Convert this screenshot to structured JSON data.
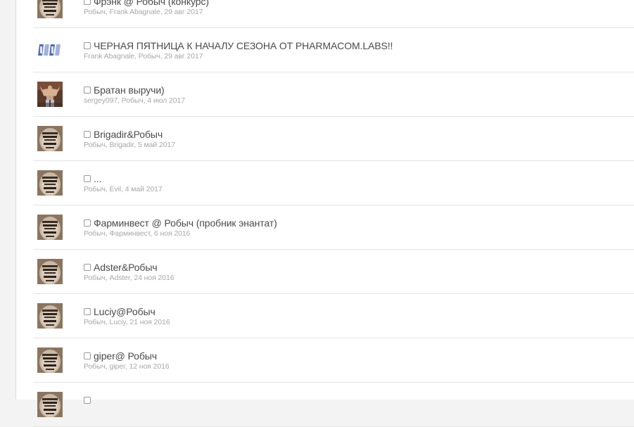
{
  "conversations": [
    {
      "title": "Фрэнк @ Робыч (конкурс)",
      "meta": "Робыч, Frank Abagnale, 29 авг 2017",
      "avatar": "robych-avatar"
    },
    {
      "title": "ЧЕРНАЯ ПЯТНИЦА К НАЧАЛУ СЕЗОНА ОТ PHARMACOM.LABS!!",
      "meta": "Frank Abagnale, Робыч, 29 авг 2017",
      "avatar": "pharmacom-logo"
    },
    {
      "title": "Братан выручи)",
      "meta": "sergey097, Робыч, 4 июл 2017",
      "avatar": "bodybuilder-avatar"
    },
    {
      "title": "Brigadir&Робыч",
      "meta": "Робыч, Brigadir, 5 май 2017",
      "avatar": "robych-avatar"
    },
    {
      "title": "...",
      "meta": "Робыч, Evil, 4 май 2017",
      "avatar": "robych-avatar"
    },
    {
      "title": "Фарминвест @ Робыч (пробник энантат)",
      "meta": "Робыч, Фарминвест, 6 ноя 2016",
      "avatar": "robych-avatar"
    },
    {
      "title": "Adster&Робыч",
      "meta": "Робыч, Adster, 24 ноя 2016",
      "avatar": "robych-avatar"
    },
    {
      "title": "Luciy@Робыч",
      "meta": "Робыч, Luciy, 21 ноя 2016",
      "avatar": "robych-avatar"
    },
    {
      "title": "giper@ Робыч",
      "meta": "Робыч, giper, 12 ноя 2016",
      "avatar": "robych-avatar"
    },
    {
      "title": "",
      "meta": "",
      "avatar": "robych-avatar"
    }
  ]
}
